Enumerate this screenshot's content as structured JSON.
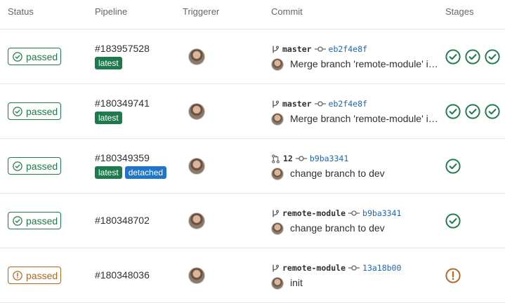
{
  "headers": {
    "status": "Status",
    "pipeline": "Pipeline",
    "triggerer": "Triggerer",
    "commit": "Commit",
    "stages": "Stages"
  },
  "colors": {
    "success": "#1f7a4c",
    "warning": "#b3661f",
    "link": "#1f66b3",
    "tag_green": "#1d7a4d",
    "tag_blue": "#1f75cb"
  },
  "rows": [
    {
      "status": "passed",
      "status_icon": "check-circle-icon",
      "id": "#183957528",
      "tags": [
        "latest"
      ],
      "ref_icon": "branch-icon",
      "ref": "master",
      "sha": "eb2f4e8f",
      "message": "Merge branch 'remote-module' into 'master'",
      "stages": [
        "success",
        "success",
        "success"
      ]
    },
    {
      "status": "passed",
      "status_icon": "check-circle-icon",
      "id": "#180349741",
      "tags": [
        "latest"
      ],
      "ref_icon": "branch-icon",
      "ref": "master",
      "sha": "eb2f4e8f",
      "message": "Merge branch 'remote-module' into 'master'",
      "stages": [
        "success",
        "success",
        "success"
      ]
    },
    {
      "status": "passed",
      "status_icon": "check-circle-icon",
      "id": "#180349359",
      "tags": [
        "latest",
        "detached"
      ],
      "ref_icon": "merge-request-icon",
      "ref": "12",
      "sha": "b9ba3341",
      "message": "change branch to dev",
      "stages": [
        "success"
      ]
    },
    {
      "status": "passed",
      "status_icon": "check-circle-icon",
      "id": "#180348702",
      "tags": [],
      "ref_icon": "branch-icon",
      "ref": "remote-module",
      "sha": "b9ba3341",
      "message": "change branch to dev",
      "stages": [
        "success"
      ]
    },
    {
      "status": "passed",
      "status_icon": "warning-circle-icon",
      "id": "#180348036",
      "tags": [],
      "ref_icon": "branch-icon",
      "ref": "remote-module",
      "sha": "13a18b00",
      "message": "init",
      "stages": [
        "warning"
      ]
    }
  ]
}
